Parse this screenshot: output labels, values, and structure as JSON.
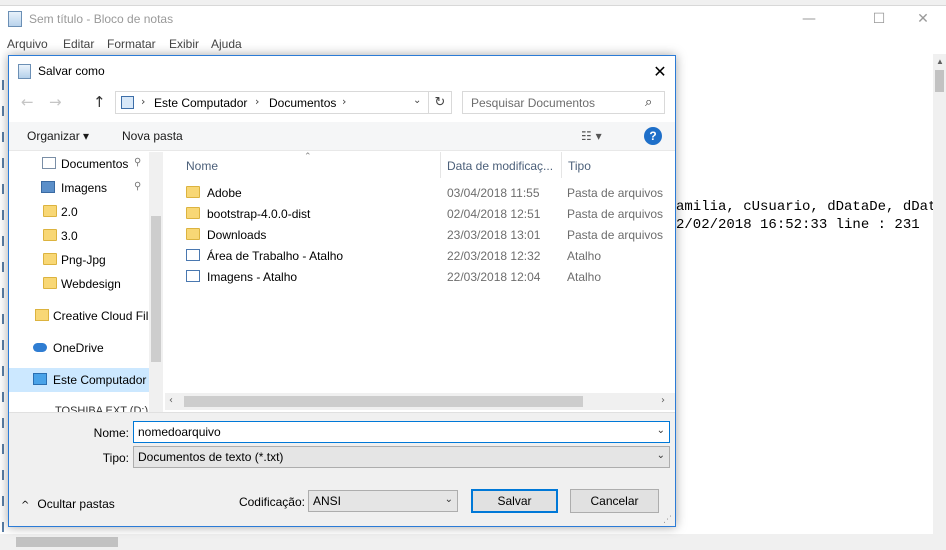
{
  "notepad": {
    "title": "Sem título - Bloco de notas",
    "window_buttons": {
      "minimize": "—",
      "maximize": "☐",
      "close": "✕"
    },
    "menu": [
      "Arquivo",
      "Editar",
      "Formatar",
      "Exibir",
      "Ajuda"
    ],
    "text_lines": [
      "amilia, cUsuario, dDataDe, dData",
      "2/02/2018 16:52:33 line : 231"
    ]
  },
  "dialog": {
    "title": "Salvar como",
    "close_glyph": "✕",
    "nav": {
      "back": "←",
      "forward": "→",
      "up": "↑"
    },
    "address": {
      "crumbs": [
        "Este Computador",
        "Documentos"
      ],
      "separator": "›",
      "dropdown": "⌄",
      "refresh": "↻"
    },
    "search": {
      "placeholder": "Pesquisar Documentos",
      "icon": "search-icon"
    },
    "toolbar": {
      "organize": "Organizar ▾",
      "new_folder": "Nova pasta",
      "view": "☷ ▾",
      "help": "?"
    },
    "sidebar": [
      {
        "label": "Documentos",
        "icon": "documents-icon",
        "pinned": true
      },
      {
        "label": "Imagens",
        "icon": "pictures-icon",
        "pinned": true
      },
      {
        "label": "2.0",
        "icon": "folder-icon"
      },
      {
        "label": "3.0",
        "icon": "folder-icon"
      },
      {
        "label": "Png-Jpg",
        "icon": "folder-icon"
      },
      {
        "label": "Webdesign",
        "icon": "folder-icon"
      },
      {
        "label": "Creative Cloud Fil",
        "icon": "creative-cloud-icon"
      },
      {
        "label": "OneDrive",
        "icon": "onedrive-icon"
      },
      {
        "label": "Este Computador",
        "icon": "computer-icon",
        "selected": true
      }
    ],
    "sidebar_partial": "TOSHIBA EXT (D:)",
    "pin_glyph": "📌",
    "columns": {
      "name": "Nome",
      "date": "Data de modificaç...",
      "type": "Tipo",
      "sort_arrow": "⌃"
    },
    "files": [
      {
        "name": "Adobe",
        "date": "03/04/2018 11:55",
        "type": "Pasta de arquivos",
        "icon": "folder-icon"
      },
      {
        "name": "bootstrap-4.0.0-dist",
        "date": "02/04/2018 12:51",
        "type": "Pasta de arquivos",
        "icon": "folder-icon"
      },
      {
        "name": "Downloads",
        "date": "23/03/2018 13:01",
        "type": "Pasta de arquivos",
        "icon": "folder-icon"
      },
      {
        "name": "Área de Trabalho - Atalho",
        "date": "22/03/2018 12:32",
        "type": "Atalho",
        "icon": "shortcut-icon"
      },
      {
        "name": "Imagens - Atalho",
        "date": "22/03/2018 12:04",
        "type": "Atalho",
        "icon": "shortcut-icon"
      }
    ],
    "filename": {
      "label": "Nome:",
      "value": "nomedoarquivo"
    },
    "filetype": {
      "label": "Tipo:",
      "value": "Documentos de texto (*.txt)"
    },
    "encoding": {
      "label": "Codificação:",
      "value": "ANSI"
    },
    "buttons": {
      "save": "Salvar",
      "cancel": "Cancelar"
    },
    "hide_folders": {
      "caret": "^",
      "label": "Ocultar pastas"
    },
    "chevron": "⌄"
  }
}
